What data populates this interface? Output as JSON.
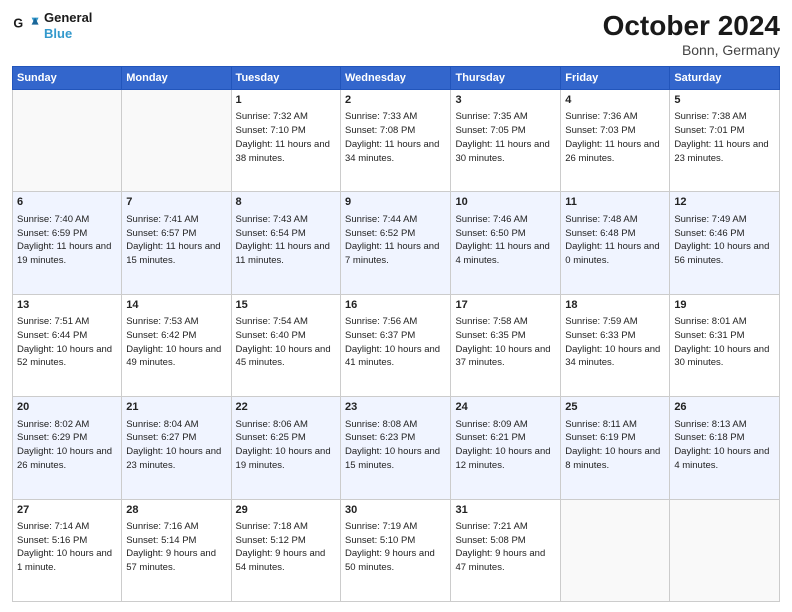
{
  "header": {
    "logo_line1": "General",
    "logo_line2": "Blue",
    "month": "October 2024",
    "location": "Bonn, Germany"
  },
  "days_of_week": [
    "Sunday",
    "Monday",
    "Tuesday",
    "Wednesday",
    "Thursday",
    "Friday",
    "Saturday"
  ],
  "weeks": [
    [
      {
        "day": "",
        "info": ""
      },
      {
        "day": "",
        "info": ""
      },
      {
        "day": "1",
        "info": "Sunrise: 7:32 AM\nSunset: 7:10 PM\nDaylight: 11 hours and 38 minutes."
      },
      {
        "day": "2",
        "info": "Sunrise: 7:33 AM\nSunset: 7:08 PM\nDaylight: 11 hours and 34 minutes."
      },
      {
        "day": "3",
        "info": "Sunrise: 7:35 AM\nSunset: 7:05 PM\nDaylight: 11 hours and 30 minutes."
      },
      {
        "day": "4",
        "info": "Sunrise: 7:36 AM\nSunset: 7:03 PM\nDaylight: 11 hours and 26 minutes."
      },
      {
        "day": "5",
        "info": "Sunrise: 7:38 AM\nSunset: 7:01 PM\nDaylight: 11 hours and 23 minutes."
      }
    ],
    [
      {
        "day": "6",
        "info": "Sunrise: 7:40 AM\nSunset: 6:59 PM\nDaylight: 11 hours and 19 minutes."
      },
      {
        "day": "7",
        "info": "Sunrise: 7:41 AM\nSunset: 6:57 PM\nDaylight: 11 hours and 15 minutes."
      },
      {
        "day": "8",
        "info": "Sunrise: 7:43 AM\nSunset: 6:54 PM\nDaylight: 11 hours and 11 minutes."
      },
      {
        "day": "9",
        "info": "Sunrise: 7:44 AM\nSunset: 6:52 PM\nDaylight: 11 hours and 7 minutes."
      },
      {
        "day": "10",
        "info": "Sunrise: 7:46 AM\nSunset: 6:50 PM\nDaylight: 11 hours and 4 minutes."
      },
      {
        "day": "11",
        "info": "Sunrise: 7:48 AM\nSunset: 6:48 PM\nDaylight: 11 hours and 0 minutes."
      },
      {
        "day": "12",
        "info": "Sunrise: 7:49 AM\nSunset: 6:46 PM\nDaylight: 10 hours and 56 minutes."
      }
    ],
    [
      {
        "day": "13",
        "info": "Sunrise: 7:51 AM\nSunset: 6:44 PM\nDaylight: 10 hours and 52 minutes."
      },
      {
        "day": "14",
        "info": "Sunrise: 7:53 AM\nSunset: 6:42 PM\nDaylight: 10 hours and 49 minutes."
      },
      {
        "day": "15",
        "info": "Sunrise: 7:54 AM\nSunset: 6:40 PM\nDaylight: 10 hours and 45 minutes."
      },
      {
        "day": "16",
        "info": "Sunrise: 7:56 AM\nSunset: 6:37 PM\nDaylight: 10 hours and 41 minutes."
      },
      {
        "day": "17",
        "info": "Sunrise: 7:58 AM\nSunset: 6:35 PM\nDaylight: 10 hours and 37 minutes."
      },
      {
        "day": "18",
        "info": "Sunrise: 7:59 AM\nSunset: 6:33 PM\nDaylight: 10 hours and 34 minutes."
      },
      {
        "day": "19",
        "info": "Sunrise: 8:01 AM\nSunset: 6:31 PM\nDaylight: 10 hours and 30 minutes."
      }
    ],
    [
      {
        "day": "20",
        "info": "Sunrise: 8:02 AM\nSunset: 6:29 PM\nDaylight: 10 hours and 26 minutes."
      },
      {
        "day": "21",
        "info": "Sunrise: 8:04 AM\nSunset: 6:27 PM\nDaylight: 10 hours and 23 minutes."
      },
      {
        "day": "22",
        "info": "Sunrise: 8:06 AM\nSunset: 6:25 PM\nDaylight: 10 hours and 19 minutes."
      },
      {
        "day": "23",
        "info": "Sunrise: 8:08 AM\nSunset: 6:23 PM\nDaylight: 10 hours and 15 minutes."
      },
      {
        "day": "24",
        "info": "Sunrise: 8:09 AM\nSunset: 6:21 PM\nDaylight: 10 hours and 12 minutes."
      },
      {
        "day": "25",
        "info": "Sunrise: 8:11 AM\nSunset: 6:19 PM\nDaylight: 10 hours and 8 minutes."
      },
      {
        "day": "26",
        "info": "Sunrise: 8:13 AM\nSunset: 6:18 PM\nDaylight: 10 hours and 4 minutes."
      }
    ],
    [
      {
        "day": "27",
        "info": "Sunrise: 7:14 AM\nSunset: 5:16 PM\nDaylight: 10 hours and 1 minute."
      },
      {
        "day": "28",
        "info": "Sunrise: 7:16 AM\nSunset: 5:14 PM\nDaylight: 9 hours and 57 minutes."
      },
      {
        "day": "29",
        "info": "Sunrise: 7:18 AM\nSunset: 5:12 PM\nDaylight: 9 hours and 54 minutes."
      },
      {
        "day": "30",
        "info": "Sunrise: 7:19 AM\nSunset: 5:10 PM\nDaylight: 9 hours and 50 minutes."
      },
      {
        "day": "31",
        "info": "Sunrise: 7:21 AM\nSunset: 5:08 PM\nDaylight: 9 hours and 47 minutes."
      },
      {
        "day": "",
        "info": ""
      },
      {
        "day": "",
        "info": ""
      }
    ]
  ]
}
